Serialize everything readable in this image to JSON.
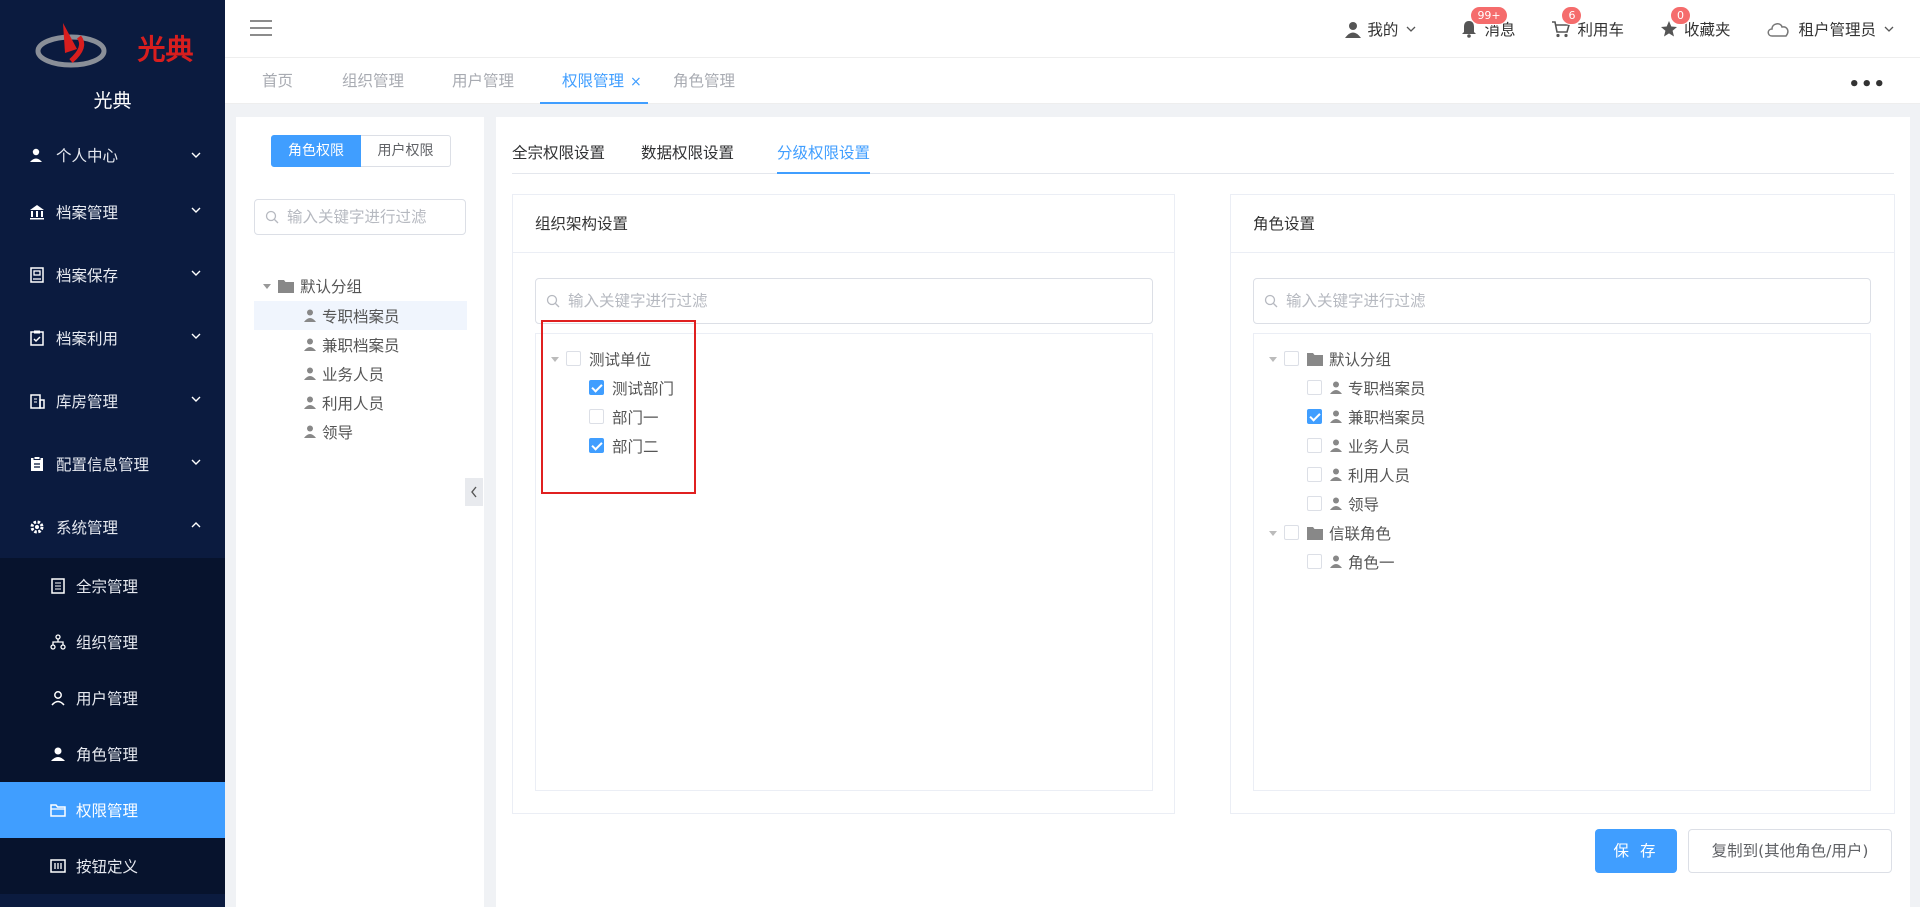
{
  "app": {
    "logo_text": "光典",
    "title": "光典"
  },
  "sidebar": {
    "menu": [
      {
        "label": "个人中心",
        "icon": "user-card-icon"
      },
      {
        "label": "档案管理",
        "icon": "bank-icon"
      },
      {
        "label": "档案保存",
        "icon": "archive-save-icon"
      },
      {
        "label": "档案利用",
        "icon": "clipboard-check-icon"
      },
      {
        "label": "库房管理",
        "icon": "warehouse-icon"
      },
      {
        "label": "配置信息管理",
        "icon": "clipboard-icon"
      },
      {
        "label": "系统管理",
        "icon": "gear-icon"
      }
    ],
    "submenu": [
      {
        "label": "全宗管理",
        "icon": "document-icon"
      },
      {
        "label": "组织管理",
        "icon": "org-chart-icon"
      },
      {
        "label": "用户管理",
        "icon": "user-outline-icon"
      },
      {
        "label": "角色管理",
        "icon": "user-solid-icon"
      },
      {
        "label": "权限管理",
        "icon": "folder-open-icon"
      },
      {
        "label": "按钮定义",
        "icon": "button-def-icon"
      }
    ],
    "active_color": "#409eff",
    "bg_color": "#0b1b3f"
  },
  "topbar": {
    "mine": "我的",
    "messages": "消息",
    "messages_badge": "99+",
    "cart": "利用车",
    "cart_badge": "6",
    "favorites": "收藏夹",
    "favorites_badge": "0",
    "user": "租户管理员"
  },
  "tabs": [
    {
      "label": "首页"
    },
    {
      "label": "组织管理"
    },
    {
      "label": "用户管理"
    },
    {
      "label": "权限管理",
      "close": "×"
    },
    {
      "label": "角色管理"
    }
  ],
  "tabs_more": "•••",
  "left_panel": {
    "seg_role": "角色权限",
    "seg_user": "用户权限",
    "search_placeholder": "输入关键字进行过滤",
    "tree": {
      "group": "默认分组",
      "items": [
        "专职档案员",
        "兼职档案员",
        "业务人员",
        "利用人员",
        "领导"
      ]
    }
  },
  "main": {
    "subtabs": [
      "全宗权限设置",
      "数据权限设置",
      "分级权限设置"
    ],
    "org_card": {
      "title": "组织架构设置",
      "search_placeholder": "输入关键字进行过滤",
      "root": "测试单位",
      "children": [
        {
          "label": "测试部门",
          "checked": true
        },
        {
          "label": "部门一",
          "checked": false
        },
        {
          "label": "部门二",
          "checked": true
        }
      ]
    },
    "role_card": {
      "title": "角色设置",
      "search_placeholder": "输入关键字进行过滤",
      "groups": [
        {
          "label": "默认分组",
          "items": [
            {
              "label": "专职档案员",
              "checked": false
            },
            {
              "label": "兼职档案员",
              "checked": true
            },
            {
              "label": "业务人员",
              "checked": false
            },
            {
              "label": "利用人员",
              "checked": false
            },
            {
              "label": "领导",
              "checked": false
            }
          ]
        },
        {
          "label": "信联角色",
          "items": [
            {
              "label": "角色一",
              "checked": false
            }
          ]
        }
      ]
    },
    "save_label": "保 存",
    "copy_label": "复制到(其他角色/用户)"
  }
}
